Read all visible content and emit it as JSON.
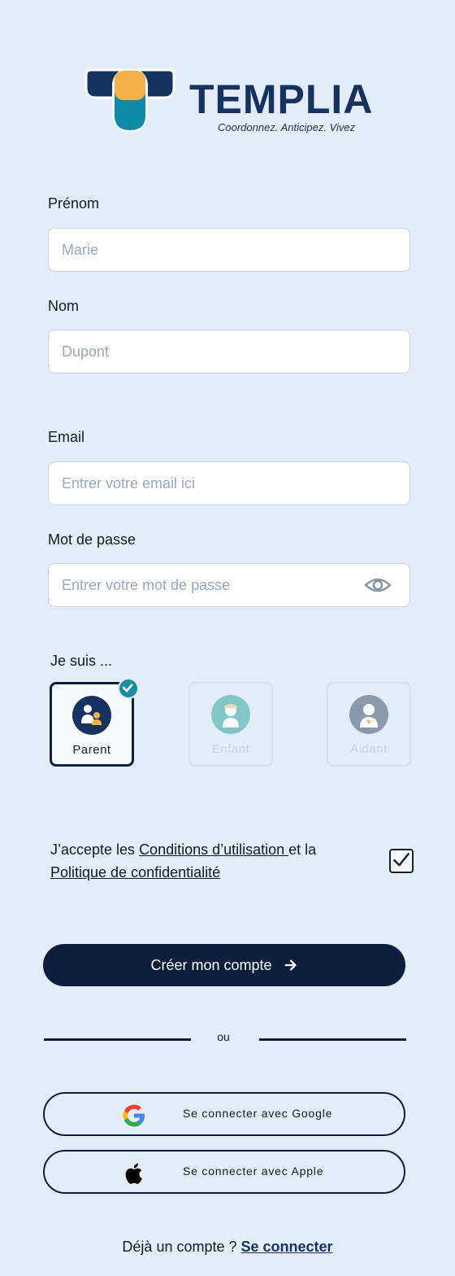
{
  "brand": {
    "name": "TEMPLIA",
    "tagline": "Coordonnez. Anticipez. Vivez",
    "colors": {
      "navy": "#163260",
      "orange": "#f5b14c",
      "teal": "#0e8aa8"
    }
  },
  "form": {
    "first_name": {
      "label": "Prénom",
      "placeholder": "Marie"
    },
    "last_name": {
      "label": "Nom",
      "placeholder": "Dupont"
    },
    "email": {
      "label": "Email",
      "placeholder": "Entrer votre email ici"
    },
    "password": {
      "label": "Mot de passe",
      "placeholder": "Entrer votre mot de passe",
      "icon": "eye-icon"
    }
  },
  "role": {
    "prompt": "Je suis ...",
    "options": [
      {
        "label": "Parent",
        "selected": true,
        "icon": "parent-icon"
      },
      {
        "label": "Enfant",
        "selected": false,
        "icon": "child-icon"
      },
      {
        "label": "Aidant",
        "selected": false,
        "icon": "caregiver-icon"
      }
    ]
  },
  "terms": {
    "prefix": "J’accepte  les ",
    "conditions_link": "Conditions d’utilisation ",
    "middle": "et la",
    "privacy_link": "Politique de confidentialité",
    "checked": true
  },
  "create_button": {
    "label": "Créer mon compte",
    "icon": "arrow-right-icon"
  },
  "divider": {
    "text": "ou"
  },
  "social": {
    "google": {
      "label": "Se connecter avec Google",
      "icon": "google-icon"
    },
    "apple": {
      "label": "Se connecter avec Apple",
      "icon": "apple-icon"
    }
  },
  "footer": {
    "prompt": "Déjà un compte ? ",
    "login_link": "Se connecter"
  }
}
